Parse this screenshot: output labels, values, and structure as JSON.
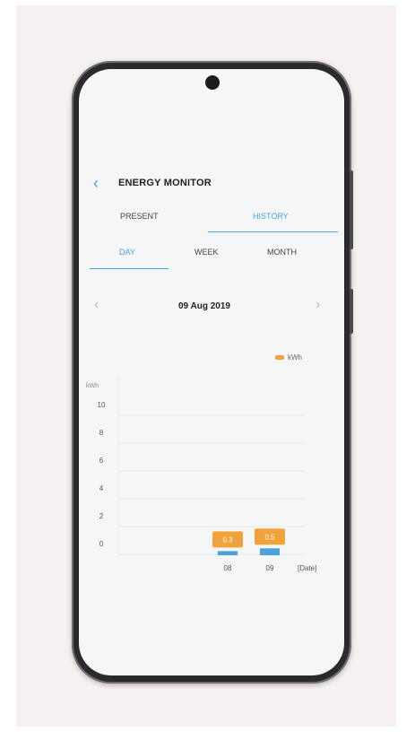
{
  "header": {
    "title": "ENERGY MONITOR"
  },
  "tabs": [
    {
      "label": "PRESENT",
      "selected": false
    },
    {
      "label": "HISTORY",
      "selected": true
    }
  ],
  "range_tabs": [
    {
      "label": "DAY",
      "selected": true
    },
    {
      "label": "WEEK",
      "selected": false
    },
    {
      "label": "MONTH",
      "selected": false
    }
  ],
  "date": "09 Aug 2019",
  "icons": {
    "back": "chevron-left-icon",
    "prev": "chevron-left-icon",
    "next": "chevron-right-icon"
  },
  "colors": {
    "accent": "#4aa3df",
    "bar_label": "#f2a23a",
    "bar": "#4aa3df"
  },
  "chart_data": {
    "type": "bar",
    "legend": [
      "kWh"
    ],
    "ylabel": "kWh",
    "xlabel": "[Date]",
    "yticks": [
      "10",
      "8",
      "6",
      "4",
      "2",
      "0"
    ],
    "ylim": [
      0,
      10
    ],
    "categories": [
      "08",
      "09"
    ],
    "values": [
      0.3,
      0.5
    ],
    "value_labels": [
      "0.3",
      "0.5"
    ]
  }
}
